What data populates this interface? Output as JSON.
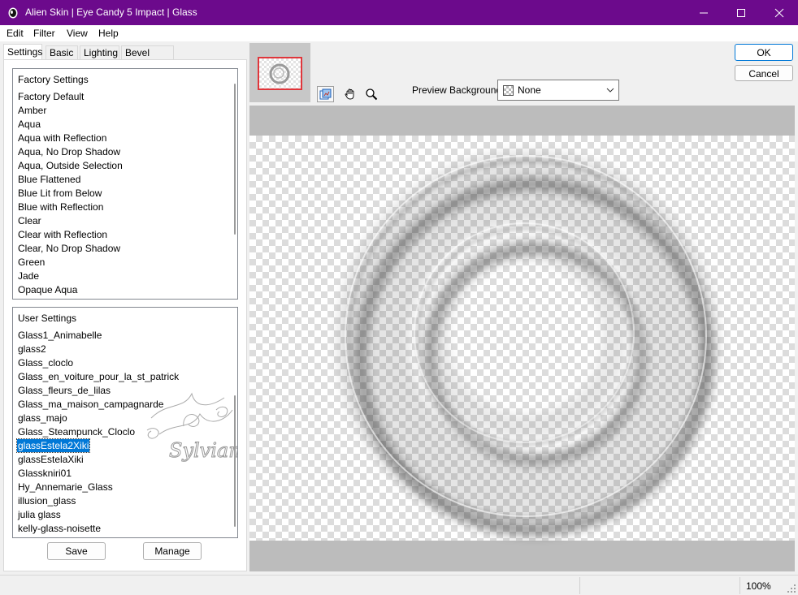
{
  "window": {
    "title": "Alien Skin | Eye Candy 5 Impact | Glass",
    "titlebar_color": "#6c0a8c"
  },
  "menu": [
    {
      "label": "Edit"
    },
    {
      "label": "Filter"
    },
    {
      "label": "View"
    },
    {
      "label": "Help"
    }
  ],
  "tabs": [
    {
      "label": "Settings",
      "active": true
    },
    {
      "label": "Basic"
    },
    {
      "label": "Lighting"
    },
    {
      "label": "Bevel Profile"
    }
  ],
  "factory_settings": {
    "header": "Factory Settings",
    "items": [
      "Factory Default",
      "Amber",
      "Aqua",
      "Aqua with Reflection",
      "Aqua, No Drop Shadow",
      "Aqua, Outside Selection",
      "Blue Flattened",
      "Blue Lit from Below",
      "Blue with Reflection",
      "Clear",
      "Clear with Reflection",
      "Clear, No Drop Shadow",
      "Green",
      "Jade",
      "Opaque Aqua"
    ]
  },
  "user_settings": {
    "header": "User Settings",
    "items": [
      "Glass1_Animabelle",
      "glass2",
      "Glass_cloclo",
      "Glass_en_voiture_pour_la_st_patrick",
      "Glass_fleurs_de_lilas",
      "Glass_ma_maison_campagnarde",
      "glass_majo",
      "Glass_Steampunck_Cloclo",
      "glassEstela2Xiki",
      "glassEstelaXiki",
      "Glasskniri01",
      "Hy_Annemarie_Glass",
      "illusion_glass",
      "julia glass",
      "kelly-glass-noisette"
    ],
    "selected": "glassEstela2Xiki"
  },
  "watermark": {
    "text": "Sylviane"
  },
  "buttons": {
    "save": "Save",
    "manage": "Manage",
    "ok": "OK",
    "cancel": "Cancel"
  },
  "toolbar": {
    "icons": [
      "preview-toggle-icon",
      "hand-pan-icon",
      "zoom-icon"
    ]
  },
  "preview_background": {
    "label": "Preview Background:",
    "value": "None"
  },
  "status": {
    "zoom": "100%"
  },
  "colors": {
    "selection": "#0078d7",
    "thumb_frame": "#e0363b"
  }
}
